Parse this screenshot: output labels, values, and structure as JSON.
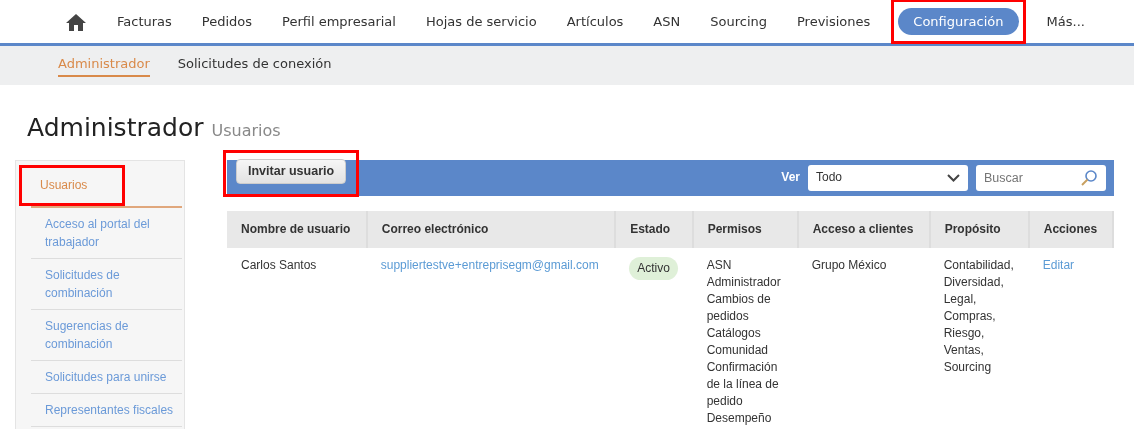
{
  "top_nav": {
    "items": [
      {
        "kind": "home",
        "selected": false,
        "highlighted": false
      },
      {
        "kind": "link",
        "label": "Facturas",
        "selected": false,
        "highlighted": false
      },
      {
        "kind": "link",
        "label": "Pedidos",
        "selected": false,
        "highlighted": false
      },
      {
        "kind": "link",
        "label": "Perfil empresarial",
        "selected": false,
        "highlighted": false
      },
      {
        "kind": "link",
        "label": "Hojas de servicio",
        "selected": false,
        "highlighted": false
      },
      {
        "kind": "link",
        "label": "Artículos",
        "selected": false,
        "highlighted": false
      },
      {
        "kind": "link",
        "label": "ASN",
        "selected": false,
        "highlighted": false
      },
      {
        "kind": "link",
        "label": "Sourcing",
        "selected": false,
        "highlighted": false
      },
      {
        "kind": "link",
        "label": "Previsiones",
        "selected": false,
        "highlighted": false
      },
      {
        "kind": "link",
        "label": "Configuración",
        "selected": true,
        "highlighted": true
      },
      {
        "kind": "link",
        "label": "Más...",
        "selected": false,
        "highlighted": false
      }
    ]
  },
  "sub_nav": {
    "items": [
      {
        "label": "Administrador",
        "selected": true
      },
      {
        "label": "Solicitudes de conexión",
        "selected": false
      }
    ]
  },
  "page_title": {
    "title": "Administrador",
    "subtitle": "Usuarios"
  },
  "sidebar": {
    "items": [
      {
        "label": "Usuarios",
        "selected": true,
        "highlighted": true
      },
      {
        "label": "Acceso al portal del trabajador",
        "selected": false,
        "highlighted": false
      },
      {
        "label": "Solicitudes de combinación",
        "selected": false,
        "highlighted": false
      },
      {
        "label": "Sugerencias de combinación",
        "selected": false,
        "highlighted": false
      },
      {
        "label": "Solicitudes para unirse",
        "selected": false,
        "highlighted": false
      },
      {
        "label": "Representantes fiscales",
        "selected": false,
        "highlighted": false
      }
    ]
  },
  "toolbar": {
    "invite_button": {
      "label": "Invitar usuario",
      "highlighted": true
    },
    "view_label": "Ver",
    "view_select": {
      "value": "Todo"
    },
    "search": {
      "placeholder": "Buscar"
    }
  },
  "table": {
    "columns": [
      "Nombre de usuario",
      "Correo electrónico",
      "Estado",
      "Permisos",
      "Acceso a clientes",
      "Propósito",
      "Acciones"
    ],
    "rows": [
      {
        "name": "Carlos Santos",
        "email": "suppliertestve+entreprisegm@gmail.com",
        "status": "Activo",
        "permissions": [
          "ASN",
          "Administrador",
          "Cambios de pedidos",
          "Catálogos",
          "Comunidad",
          "Confirmación de la línea de pedido",
          "Desempeño"
        ],
        "customer_access": "Grupo México",
        "purposes": [
          "Contabilidad,",
          "Diversidad,",
          "Legal,",
          "Compras,",
          "Riesgo,",
          "Ventas,",
          "Sourcing"
        ],
        "action": "Editar"
      }
    ]
  }
}
